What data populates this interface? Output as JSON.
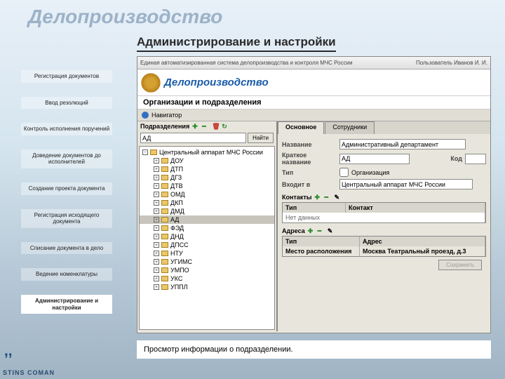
{
  "watermark": "Делопроизводство",
  "section_title": "Администрирование и настройки",
  "sidebar": {
    "items": [
      "Регистрация документов",
      "Ввод резолюций",
      "Контроль исполнения поручений",
      "Доведение документов до исполнителей",
      "Создание проекта документа",
      "Регистрация исходящего документа",
      "Списание документа в дело",
      "Ведение номенклатуры",
      "Администрирование и настройки"
    ],
    "active_index": 8
  },
  "app": {
    "system_text": "Единая автоматизированная система делопроизводства и контроля МЧС России",
    "user_label": "Пользователь",
    "user_name": "Иванов И. И.",
    "title": "Делопроизводство",
    "sub_title": "Организации и подразделения",
    "navigator": "Навигатор",
    "left": {
      "header": "Подразделения",
      "search_value": "АД",
      "find_btn": "Найти",
      "root": "Центральный аппарат МЧС России",
      "nodes": [
        "ДОУ",
        "ДТП",
        "ДГЗ",
        "ДТВ",
        "ОМД",
        "ДКП",
        "ДМД",
        "АД",
        "ФЭД",
        "ДНД",
        "ДПСС",
        "НТУ",
        "УГИМС",
        "УМПО",
        "УКС",
        "УППЛ"
      ],
      "selected": "АД"
    },
    "tabs": {
      "items": [
        "Основное",
        "Сотрудники"
      ],
      "active": 0
    },
    "form": {
      "name_label": "Название",
      "name_value": "Административный департамент",
      "short_label": "Краткое название",
      "short_value": "АД",
      "code_label": "Код",
      "type_label": "Тип",
      "type_check": "Организация",
      "parent_label": "Входит в",
      "parent_value": "Центральный аппарат МЧС России"
    },
    "contacts": {
      "header": "Контакты",
      "cols": [
        "Тип",
        "Контакт"
      ],
      "empty": "Нет данных"
    },
    "addresses": {
      "header": "Адреса",
      "cols": [
        "Тип",
        "Адрес"
      ],
      "row": {
        "type": "Место расположения",
        "city": "Москва",
        "addr": "Театральный проезд, д.3"
      }
    },
    "save_btn": "Сохранить"
  },
  "caption": "Просмотр информации о подразделении.",
  "footer": "STINS COMAN"
}
